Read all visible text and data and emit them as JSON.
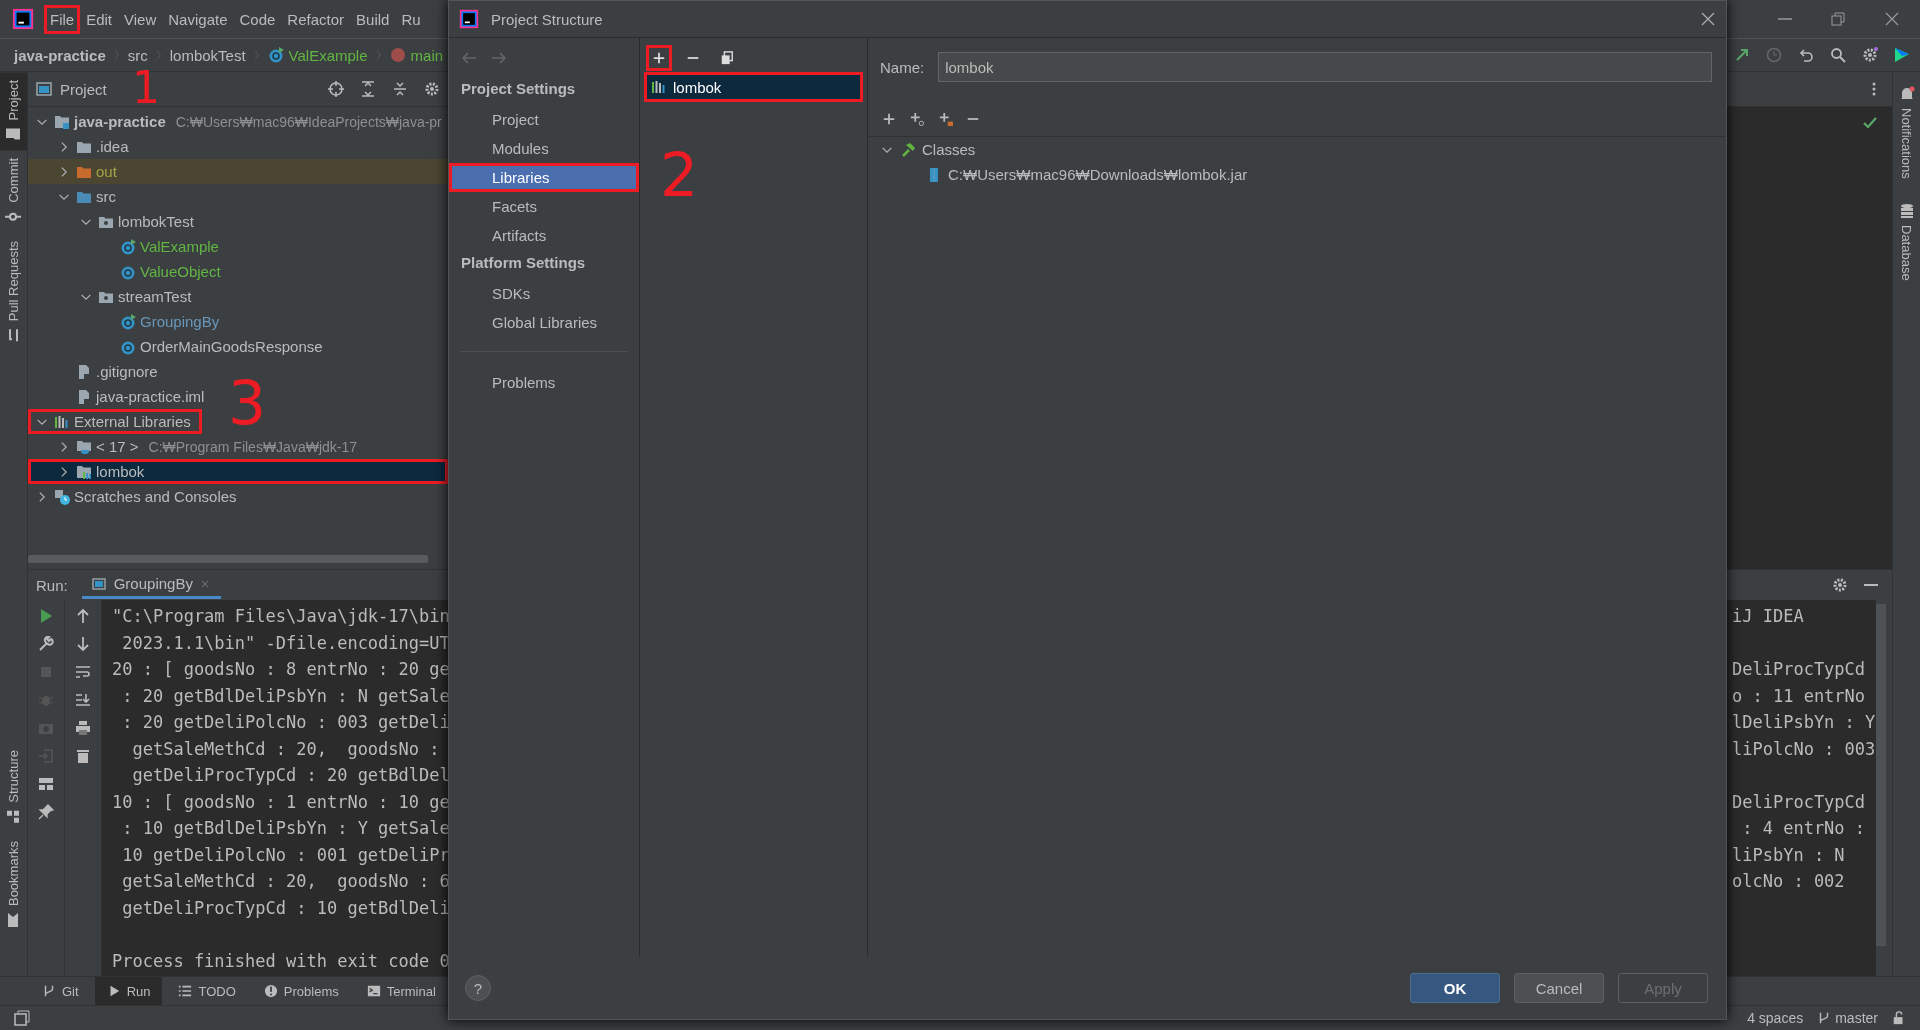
{
  "menu_bar": {
    "items": [
      {
        "label": "File",
        "highlighted": true
      },
      {
        "label": "Edit",
        "highlighted": false
      },
      {
        "label": "View",
        "highlighted": false
      },
      {
        "label": "Navigate",
        "highlighted": false
      },
      {
        "label": "Code",
        "highlighted": false
      },
      {
        "label": "Refactor",
        "highlighted": false
      },
      {
        "label": "Build",
        "highlighted": false
      },
      {
        "label": "Ru",
        "highlighted": false
      }
    ]
  },
  "breadcrumb": [
    {
      "label": "java-practice",
      "kind": "project"
    },
    {
      "label": "src",
      "kind": "folder"
    },
    {
      "label": "lombokTest",
      "kind": "folder"
    },
    {
      "label": "ValExample",
      "kind": "class"
    },
    {
      "label": "main",
      "kind": "method"
    }
  ],
  "left_strip": [
    {
      "label": "Project",
      "selected": true,
      "kind": "folder"
    },
    {
      "label": "Commit",
      "selected": false,
      "kind": "commit"
    },
    {
      "label": "Pull Requests",
      "selected": false,
      "kind": "pull"
    },
    {
      "label": "Structure",
      "selected": false,
      "kind": "structure"
    },
    {
      "label": "Bookmarks",
      "selected": false,
      "kind": "bookmark"
    }
  ],
  "project_panel": {
    "title": "Project",
    "tree": [
      {
        "label": "java-practice",
        "path": "C:₩Users₩mac96₩IdeaProjects₩java-pr",
        "kind": "project",
        "expanded": true,
        "color": "#bbbbbb",
        "excluded": false,
        "selected": false,
        "highlighted": false,
        "children": [
          {
            "label": ".idea",
            "kind": "folder",
            "expanded": false,
            "color": "#bbbbbb",
            "excluded": false,
            "selected": false,
            "highlighted": false
          },
          {
            "label": "out",
            "kind": "folder-excluded",
            "expanded": false,
            "color": "#a8a346",
            "excluded": true,
            "selected": false,
            "highlighted": false
          },
          {
            "label": "src",
            "kind": "source-folder",
            "expanded": true,
            "color": "#bbbbbb",
            "excluded": false,
            "selected": false,
            "highlighted": false,
            "children": [
              {
                "label": "lombokTest",
                "kind": "package",
                "expanded": true,
                "color": "#bbbbbb",
                "excluded": false,
                "selected": false,
                "highlighted": false,
                "children": [
                  {
                    "label": "ValExample",
                    "kind": "class-runnable",
                    "color": "#62b543",
                    "excluded": false,
                    "selected": false,
                    "highlighted": false
                  },
                  {
                    "label": "ValueObject",
                    "kind": "class",
                    "color": "#62b543",
                    "excluded": false,
                    "selected": false,
                    "highlighted": false
                  }
                ]
              },
              {
                "label": "streamTest",
                "kind": "package",
                "expanded": true,
                "color": "#bbbbbb",
                "excluded": false,
                "selected": false,
                "highlighted": false,
                "children": [
                  {
                    "label": "GroupingBy",
                    "kind": "class-runnable",
                    "color": "#6897bb",
                    "excluded": false,
                    "selected": false,
                    "highlighted": false
                  },
                  {
                    "label": "OrderMainGoodsResponse",
                    "kind": "class",
                    "color": "#bbbbbb",
                    "excluded": false,
                    "selected": false,
                    "highlighted": false
                  }
                ]
              }
            ]
          },
          {
            "label": ".gitignore",
            "kind": "file",
            "color": "#bbbbbb",
            "excluded": false,
            "selected": false,
            "highlighted": false
          },
          {
            "label": "java-practice.iml",
            "kind": "file",
            "color": "#bbbbbb",
            "excluded": false,
            "selected": false,
            "highlighted": false
          }
        ]
      },
      {
        "label": "External Libraries",
        "kind": "libraries",
        "expanded": true,
        "excluded": false,
        "selected": false,
        "highlighted": true,
        "children": [
          {
            "label": "< 17 >",
            "path": "C:₩Program Files₩Java₩jdk-17",
            "kind": "jdk",
            "expanded": false,
            "color": "#bbbbbb",
            "excluded": false,
            "selected": false,
            "highlighted": false
          },
          {
            "label": "lombok",
            "kind": "library",
            "expanded": false,
            "excluded": false,
            "selected": true,
            "highlighted": true
          }
        ]
      },
      {
        "label": "Scratches and Consoles",
        "kind": "scratches",
        "expanded": false,
        "color": "#bbbbbb",
        "excluded": false,
        "selected": false,
        "highlighted": false
      }
    ]
  },
  "run_panel": {
    "label": "Run:",
    "tabs": [
      {
        "label": "GroupingBy",
        "selected": true
      }
    ],
    "console": [
      [
        "\"C:\\Program Files\\Java\\jdk-17\\bin",
        " 2023.1.1\\bin\" -Dfile.encoding=UT",
        "20 : [ goodsNo : 8 entrNo : 20 ge",
        " : 20 getBdlDeliPsbYn : N getSale",
        " : 20 getDeliPolcNo : 003 getDeli",
        "  getSaleMethCd : 20,  goodsNo :",
        "  getDeliProcTypCd : 20 getBdlDel",
        "10 : [ goodsNo : 1 entrNo : 10 ge",
        " : 10 getBdlDeliPsbYn : Y getSale",
        " 10 getDeliPolcNo : 001 getDeliPr",
        " getSaleMethCd : 20,  goodsNo : 6",
        " getDeliProcTypCd : 10 getBdlDeli"
      ],
      [
        "Process finished with exit code 0"
      ]
    ],
    "console_right": [
      [
        "iJ IDEA"
      ],
      [
        "DeliProcTypCd",
        "o : 11 entrNo",
        "lDeliPsbYn : Y",
        "liPolcNo : 003"
      ],
      [
        "DeliProcTypCd",
        " : 4 entrNo :",
        "liPsbYn : N",
        "olcNo : 002"
      ]
    ]
  },
  "bottom_tabs": [
    {
      "label": "Git",
      "kind": "git",
      "selected": false
    },
    {
      "label": "Run",
      "kind": "run",
      "selected": true
    },
    {
      "label": "TODO",
      "kind": "todo",
      "selected": false
    },
    {
      "label": "Problems",
      "kind": "problems",
      "selected": false
    },
    {
      "label": "Terminal",
      "kind": "terminal",
      "selected": false
    }
  ],
  "right_strip": [
    {
      "label": "Notifications",
      "kind": "bell"
    },
    {
      "label": "Database",
      "kind": "database"
    }
  ],
  "status_bar": {
    "items": [
      {
        "label": "4 spaces",
        "kind": "text"
      },
      {
        "label": "master",
        "kind": "branch"
      }
    ]
  },
  "dialog": {
    "title": "Project Structure",
    "nav": [
      {
        "kind": "header",
        "label": "Project Settings"
      },
      {
        "kind": "item",
        "label": "Project",
        "selected": false,
        "highlighted": false
      },
      {
        "kind": "item",
        "label": "Modules",
        "selected": false,
        "highlighted": false
      },
      {
        "kind": "item",
        "label": "Libraries",
        "selected": true,
        "highlighted": true
      },
      {
        "kind": "item",
        "label": "Facets",
        "selected": false,
        "highlighted": false
      },
      {
        "kind": "item",
        "label": "Artifacts",
        "selected": false,
        "highlighted": false
      },
      {
        "kind": "header",
        "label": "Platform Settings"
      },
      {
        "kind": "item",
        "label": "SDKs",
        "selected": false,
        "highlighted": false
      },
      {
        "kind": "item",
        "label": "Global Libraries",
        "selected": false,
        "highlighted": false
      },
      {
        "kind": "separator"
      },
      {
        "kind": "item",
        "label": "Problems",
        "selected": false,
        "highlighted": false
      }
    ],
    "list_toolbar": [
      {
        "kind": "add",
        "highlighted": true
      },
      {
        "kind": "remove",
        "highlighted": false
      },
      {
        "kind": "copy",
        "highlighted": false
      }
    ],
    "libraries": [
      {
        "label": "lombok",
        "selected": true,
        "highlighted": true
      }
    ],
    "name_label": "Name:",
    "name_value": "lombok",
    "classes": {
      "label": "Classes",
      "expanded": true,
      "children": [
        {
          "label": "C:₩Users₩mac96₩Downloads₩lombok.jar"
        }
      ]
    },
    "help_button": "?",
    "buttons": [
      {
        "label": "OK",
        "kind": "primary"
      },
      {
        "label": "Cancel",
        "kind": "normal"
      },
      {
        "label": "Apply",
        "kind": "disabled"
      }
    ]
  },
  "annotations": [
    {
      "label": "1"
    },
    {
      "label": "2"
    },
    {
      "label": "3"
    }
  ]
}
